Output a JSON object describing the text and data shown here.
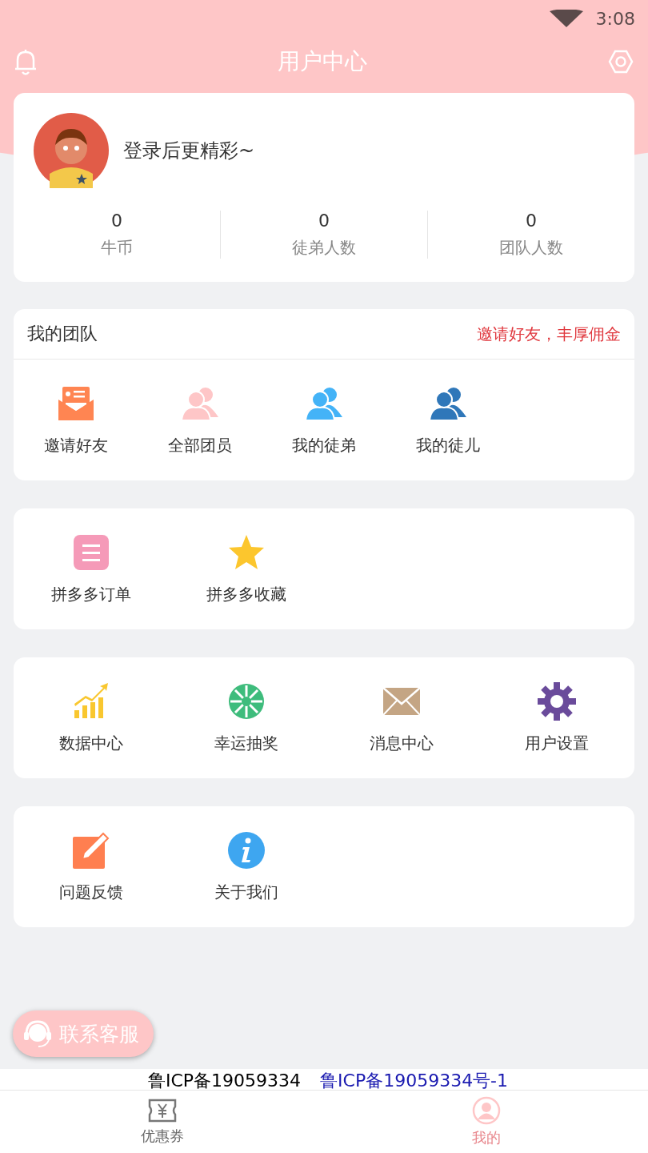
{
  "status_bar": {
    "time": "3:08"
  },
  "header": {
    "title": "用户中心"
  },
  "profile": {
    "name": "登录后更精彩~",
    "stats": [
      {
        "value": "0",
        "label": "牛币"
      },
      {
        "value": "0",
        "label": "徒弟人数"
      },
      {
        "value": "0",
        "label": "团队人数"
      }
    ]
  },
  "team": {
    "title": "我的团队",
    "link": "邀请好友，丰厚佣金",
    "items": [
      {
        "kind": "invite",
        "label": "邀请好友"
      },
      {
        "kind": "members-light",
        "label": "全部团员"
      },
      {
        "kind": "members",
        "label": "我的徒弟"
      },
      {
        "kind": "members-dark",
        "label": "我的徒儿"
      }
    ]
  },
  "sections": [
    [
      {
        "kind": "order",
        "label": "拼多多订单"
      },
      {
        "kind": "star",
        "label": "拼多多收藏"
      }
    ],
    [
      {
        "kind": "chart",
        "label": "数据中心"
      },
      {
        "kind": "wheel",
        "label": "幸运抽奖"
      },
      {
        "kind": "mail",
        "label": "消息中心"
      },
      {
        "kind": "gear",
        "label": "用户设置"
      }
    ],
    [
      {
        "kind": "edit",
        "label": "问题反馈"
      },
      {
        "kind": "info",
        "label": "关于我们"
      }
    ]
  ],
  "service_button": "联系客服",
  "icp": {
    "text": "鲁ICP备19059334",
    "link": "鲁ICP备19059334号-1"
  },
  "bottom_nav": [
    {
      "kind": "coupon",
      "label": "优惠券",
      "selected": false
    },
    {
      "kind": "user",
      "label": "我的",
      "selected": true
    }
  ]
}
